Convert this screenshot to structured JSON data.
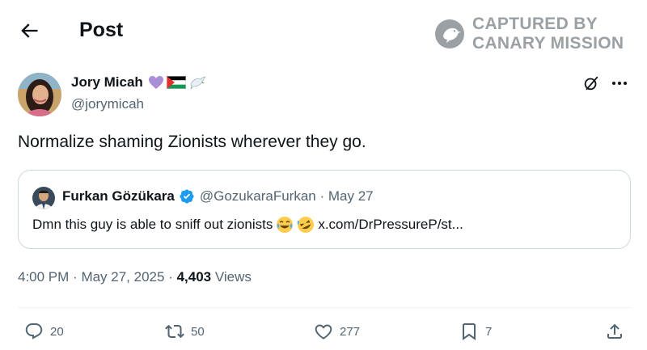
{
  "header": {
    "title": "Post",
    "back_icon": "arrow-left-icon"
  },
  "watermark": {
    "line1": "CAPTURED BY",
    "line2": "CANARY MISSION"
  },
  "post": {
    "author_name": "Jory Micah",
    "author_handle": "@jorymicah",
    "name_emojis": [
      "purple-heart-icon",
      "palestine-flag-icon",
      "dove-icon"
    ],
    "text": "Normalize shaming Zionists wherever they go.",
    "time": "4:00 PM",
    "date": "May 27, 2025",
    "views_count": "4,403",
    "views_label": "Views"
  },
  "quote": {
    "author_name": "Furkan Gözükara",
    "author_handle": "@GozukaraFurkan",
    "date": "May 27",
    "text": "Dmn this guy is able to sniff out zionists",
    "link": "x.com/DrPressureP/st..."
  },
  "actions": {
    "replies": "20",
    "reposts": "50",
    "likes": "277",
    "bookmarks": "7"
  },
  "colors": {
    "text_primary": "#0f1419",
    "text_secondary": "#536471",
    "border": "#cfd9de",
    "verified": "#1d9bf0",
    "watermark": "#9aa0a4"
  }
}
